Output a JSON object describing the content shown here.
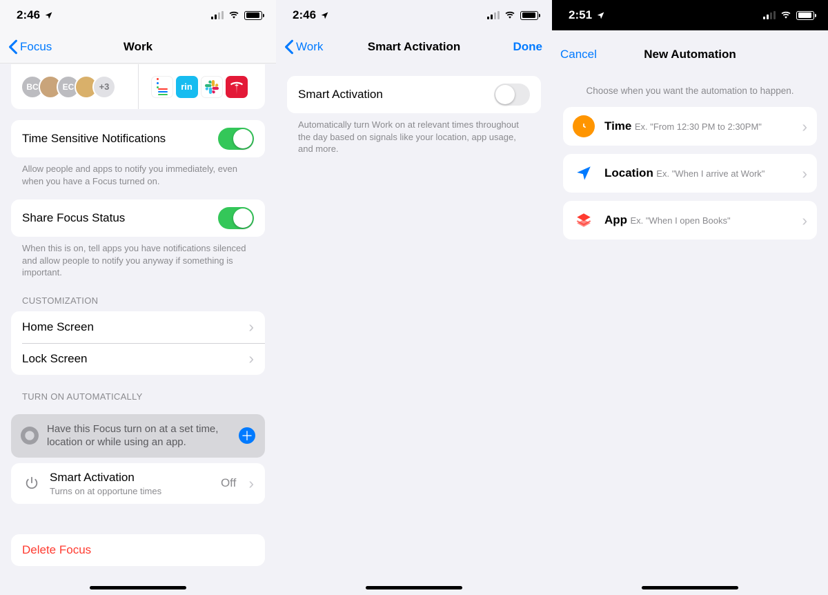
{
  "s1": {
    "time": "2:46",
    "back": "Focus",
    "title": "Work",
    "people_more": "+3",
    "tsn_label": "Time Sensitive Notifications",
    "tsn_footer": "Allow people and apps to notify you immediately, even when you have a Focus turned on.",
    "sfs_label": "Share Focus Status",
    "sfs_footer": "When this is on, tell apps you have notifications silenced and allow people to notify you anyway if something is important.",
    "custom_header": "Customization",
    "home": "Home Screen",
    "lock": "Lock Screen",
    "auto_header": "Turn On Automatically",
    "auto_hint": "Have this Focus turn on at a set time, location or while using an app.",
    "smart_label": "Smart Activation",
    "smart_sub": "Turns on at opportune times",
    "smart_value": "Off",
    "delete": "Delete Focus"
  },
  "s2": {
    "time": "2:46",
    "back": "Work",
    "title": "Smart Activation",
    "done": "Done",
    "row_label": "Smart Activation",
    "footer": "Automatically turn Work on at relevant times throughout the day based on signals like your location, app usage, and more."
  },
  "s3": {
    "time": "2:51",
    "cancel": "Cancel",
    "title": "New Automation",
    "prompt": "Choose when you want the automation to happen.",
    "opts": [
      {
        "title": "Time",
        "sub": "Ex. \"From 12:30 PM to 2:30PM\""
      },
      {
        "title": "Location",
        "sub": "Ex. \"When I arrive at Work\""
      },
      {
        "title": "App",
        "sub": "Ex. \"When I open Books\""
      }
    ]
  }
}
